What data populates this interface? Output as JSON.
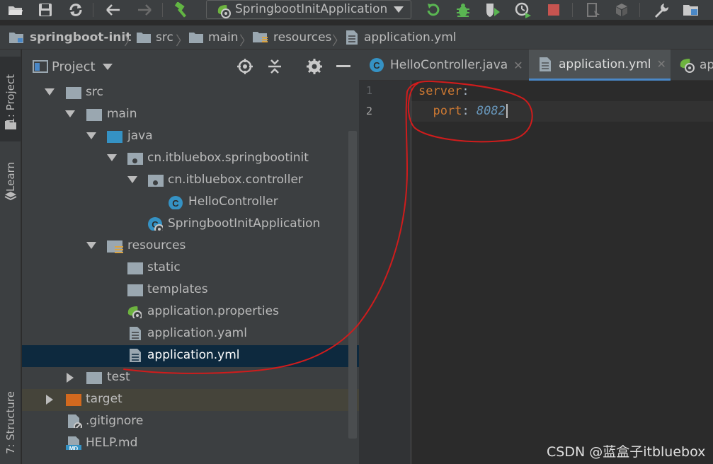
{
  "toolbar": {
    "run_config": "SpringbootInitApplication"
  },
  "breadcrumb": [
    {
      "label": "springboot-init"
    },
    {
      "label": "src"
    },
    {
      "label": "main"
    },
    {
      "label": "resources"
    },
    {
      "label": "application.yml"
    }
  ],
  "left_strip": {
    "project_tab": "1: Project",
    "learn_tab": "Learn",
    "structure_tab": "7: Structure"
  },
  "project_panel": {
    "title": "Project",
    "tree": [
      {
        "label": "src",
        "icon": "folder-icon",
        "expanded": true
      },
      {
        "label": "main",
        "icon": "folder-icon",
        "expanded": true
      },
      {
        "label": "java",
        "icon": "source-folder-icon",
        "expanded": true
      },
      {
        "label": "cn.itbluebox.springbootinit",
        "icon": "package-icon",
        "expanded": true
      },
      {
        "label": "cn.itbluebox.controller",
        "icon": "package-icon",
        "expanded": true
      },
      {
        "label": "HelloController",
        "icon": "class-icon"
      },
      {
        "label": "SpringbootInitApplication",
        "icon": "spring-class-icon"
      },
      {
        "label": "resources",
        "icon": "resources-folder-icon",
        "expanded": true
      },
      {
        "label": "static",
        "icon": "folder-icon"
      },
      {
        "label": "templates",
        "icon": "folder-icon"
      },
      {
        "label": "application.properties",
        "icon": "spring-properties-icon"
      },
      {
        "label": "application.yaml",
        "icon": "file-icon"
      },
      {
        "label": "application.yml",
        "icon": "file-icon",
        "selected": true
      },
      {
        "label": "test",
        "icon": "folder-icon",
        "expanded": false
      },
      {
        "label": "target",
        "icon": "excluded-folder-icon",
        "expanded": false
      },
      {
        "label": ".gitignore",
        "icon": "gitignore-icon"
      },
      {
        "label": "HELP.md",
        "icon": "markdown-icon"
      }
    ]
  },
  "editor": {
    "tabs": [
      {
        "label": "HelloController.java",
        "active": false
      },
      {
        "label": "application.yml",
        "active": true
      },
      {
        "label": "ap",
        "active": false
      }
    ],
    "line_numbers": [
      "1",
      "2"
    ],
    "lines": [
      {
        "indent": "",
        "key": "server",
        "colon": ":",
        "value": ""
      },
      {
        "indent": "  ",
        "key": "port",
        "colon": ": ",
        "value": "8082"
      }
    ]
  },
  "watermark": "CSDN @蓝盒子itbluebox",
  "colors": {
    "accent": "#4a88c7",
    "annotation": "#d01c1c",
    "yaml_key": "#cc7832",
    "yaml_number": "#6897bb"
  }
}
